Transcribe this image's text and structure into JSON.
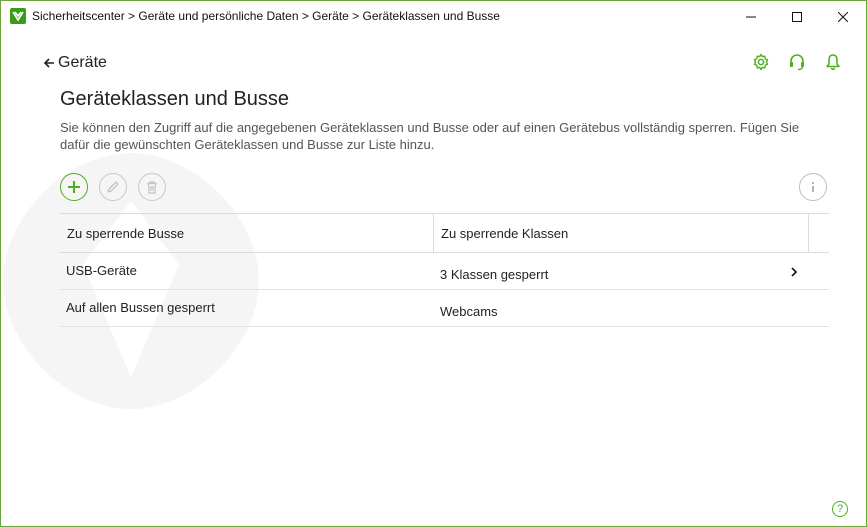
{
  "window": {
    "title": "Sicherheitscenter > Geräte und persönliche Daten > Geräte > Geräteklassen und Busse"
  },
  "nav": {
    "back_label": "Geräte"
  },
  "header_icons": [
    "gear-icon",
    "headset-icon",
    "bell-icon"
  ],
  "page": {
    "title": "Geräteklassen und Busse",
    "description": "Sie können den Zugriff auf die angegebenen Geräteklassen und Busse oder auf einen Gerätebus vollständig sperren. Fügen Sie dafür die gewünschten Geräteklassen und Busse zur Liste hinzu."
  },
  "toolbar": {
    "add_icon": "plus-icon",
    "edit_icon": "pencil-icon",
    "delete_icon": "trash-icon",
    "info_icon": "info-icon"
  },
  "table": {
    "columns": [
      "Zu sperrende Busse",
      "Zu sperrende Klassen"
    ],
    "rows": [
      {
        "bus": "USB-Geräte",
        "classes": "3 Klassen gesperrt",
        "has_details": true
      },
      {
        "bus": "Auf allen Bussen gesperrt",
        "classes": "Webcams",
        "has_details": false
      }
    ]
  },
  "footer": {
    "help_label": "?"
  },
  "colors": {
    "accent": "#4caf1f",
    "border": "#6aa43a",
    "text": "#222222",
    "muted": "#555555"
  }
}
